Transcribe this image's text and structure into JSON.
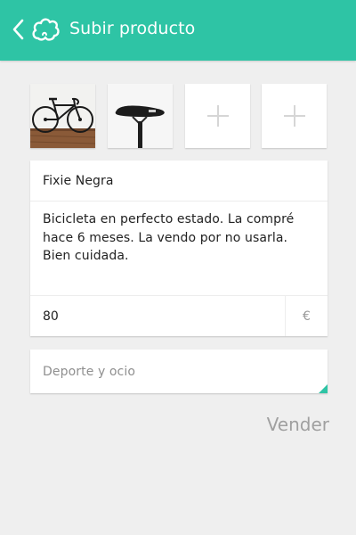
{
  "header": {
    "title": "Subir producto",
    "back_icon": "chevron-left-icon",
    "logo_icon": "cloud-logo-icon",
    "background_color": "#2ec4a5"
  },
  "photos": [
    {
      "name": "bicycle-photo",
      "kind": "image"
    },
    {
      "name": "saddle-photo",
      "kind": "image"
    },
    {
      "name": "add-photo",
      "kind": "plus-icon"
    },
    {
      "name": "add-photo",
      "kind": "plus-icon"
    }
  ],
  "form": {
    "title_value": "Fixie Negra",
    "description_lines": [
      "Bicicleta en perfecto estado. La compré",
      "hace 6 meses. La vendo por no usarla.",
      "Bien cuidada."
    ],
    "price_value": "80",
    "currency_symbol": "€",
    "category_value": "Deporte y ocio"
  },
  "actions": {
    "submit_label": "Vender"
  },
  "colors": {
    "accent": "#2ec4a5",
    "background": "#efefef"
  }
}
